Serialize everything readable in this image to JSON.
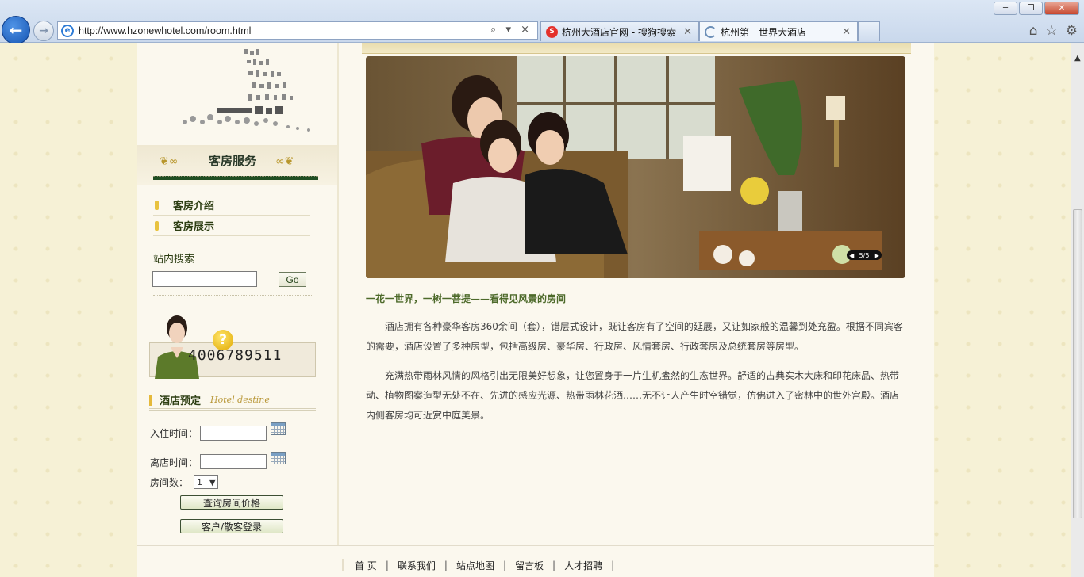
{
  "browser": {
    "url": "http://www.hzonewhotel.com/room.html",
    "address_controls": "⌕ ▾ ×",
    "tabs": [
      {
        "title": "杭州大酒店官网 - 搜狗搜索",
        "icon": "sogou-icon"
      },
      {
        "title": "杭州第一世界大酒店",
        "icon": "loading-icon",
        "active": true
      }
    ],
    "window_buttons": [
      "minimize",
      "restore",
      "close"
    ],
    "toolbar_icons": [
      "home-icon",
      "favorites-star-icon",
      "settings-gear-icon"
    ]
  },
  "sidebar": {
    "service_title": "客房服务",
    "items": [
      {
        "label": "客房介绍"
      },
      {
        "label": "客房展示"
      }
    ],
    "search": {
      "label": "站内搜索",
      "value": "",
      "go_label": "Go"
    },
    "hotline": "4006789511",
    "booking": {
      "title": "酒店预定",
      "subtitle": "Hotel destine",
      "checkin_label": "入住时间：",
      "checkout_label": "离店时间：",
      "checkin_value": "",
      "checkout_value": "",
      "rooms_label": "房间数：",
      "rooms_value": "1",
      "query_button": "查询房间价格",
      "login_button": "客户/散客登录"
    }
  },
  "main": {
    "slide_indicator": "5/5",
    "headline": "一花一世界，一树一菩提——看得见风景的房间",
    "paragraphs": [
      "酒店拥有各种豪华客房360余间（套），错层式设计，既让客房有了空间的延展，又让如家般的温馨到处充盈。根据不同宾客的需要，酒店设置了多种房型，包括高级房、豪华房、行政房、风情套房、行政套房及总统套房等房型。",
      "充满热带雨林风情的风格引出无限美好想象，让您置身于一片生机盎然的生态世界。舒适的古典实木大床和印花床品、热带动、植物图案造型无处不在、先进的感应光源、热带雨林花洒……无不让人产生时空错觉，仿佛进入了密林中的世外宫殿。酒店内侧客房均可近赏中庭美景。"
    ]
  },
  "footer": {
    "links": [
      "首 页",
      "联系我们",
      "站点地图",
      "留言板",
      "人才招聘"
    ],
    "separator": "|"
  },
  "colors": {
    "page_bg": "#f6f1d6",
    "accent_green": "#1f4e22",
    "accent_gold": "#e5b93b",
    "headline_green": "#4d6a2a"
  }
}
